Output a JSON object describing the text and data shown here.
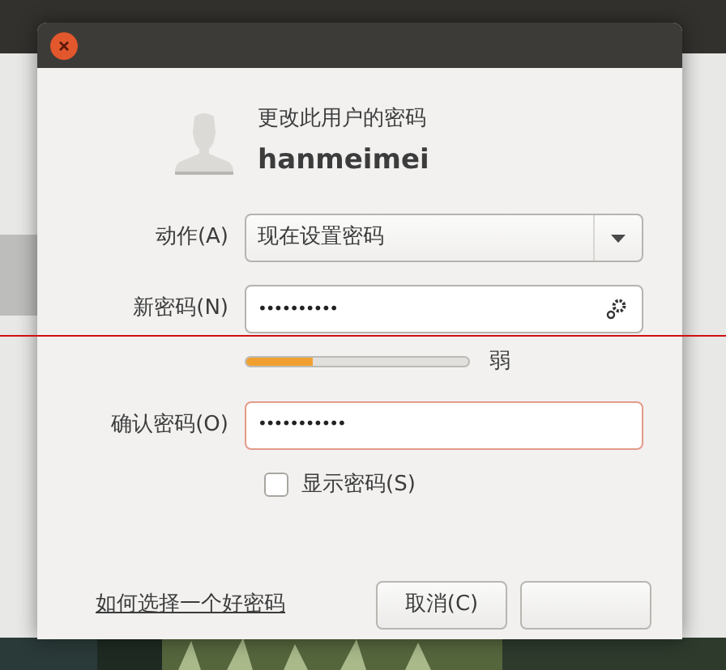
{
  "dialog": {
    "heading": "更改此用户的密码",
    "username": "hanmeimei",
    "fields": [
      {
        "kind": "dropdown",
        "label": "动作(A)",
        "value": "现在设置密码"
      },
      {
        "kind": "password",
        "label": "新密码(N)",
        "value": "••••••••••"
      },
      {
        "kind": "strength",
        "level": 0.3,
        "reading": "弱"
      },
      {
        "kind": "confirm",
        "label": "确认密码(O)",
        "value": "•••••••••••",
        "error": true
      }
    ],
    "show_password": {
      "label": "显示密码(S)",
      "checked": false
    },
    "help_link": "如何选择一个好密码",
    "buttons": [
      {
        "kind": "cancel",
        "label": "取消(C)"
      },
      {
        "kind": "hidden-label"
      }
    ]
  }
}
